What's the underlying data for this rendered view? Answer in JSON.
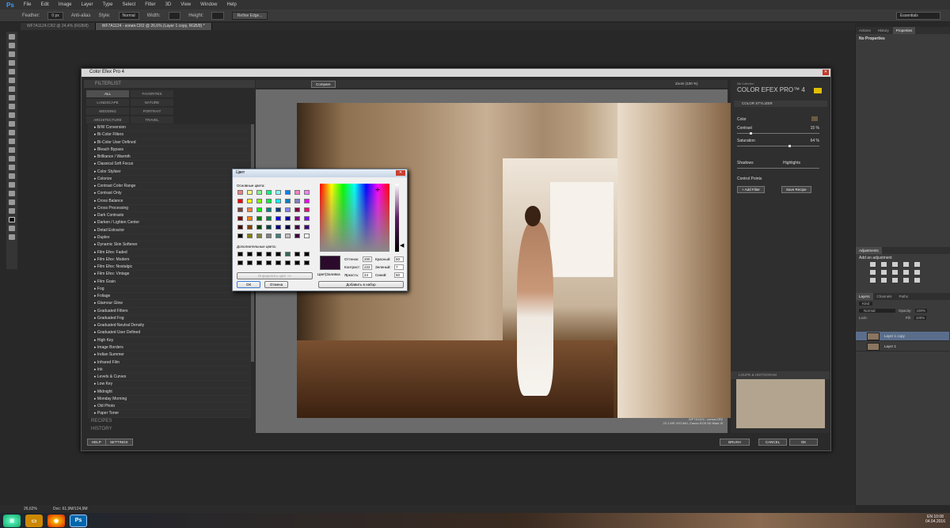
{
  "menubar": {
    "logo": "Ps",
    "items": [
      "File",
      "Edit",
      "Image",
      "Layer",
      "Type",
      "Select",
      "Filter",
      "3D",
      "View",
      "Window",
      "Help"
    ]
  },
  "options": {
    "feather_label": "Feather:",
    "feather_value": "0 px",
    "antialias": "Anti-alias",
    "style_label": "Style:",
    "style_value": "Normal",
    "width_label": "Width:",
    "height_label": "Height:",
    "refine_edge": "Refine Edge...",
    "workspace": "Essentials"
  },
  "doc_tabs": [
    "WF7A1124.CR2 @ 24,4% (RGB/8)",
    "WF7A1124 - копия.CR2 @ 26,6% (Layer 1 copy, RGB/8) *"
  ],
  "plugin": {
    "title": "Color Efex Pro 4",
    "filterlist_head": "FILTERLIST",
    "categories": [
      [
        "ALL",
        "FAVORITES"
      ],
      [
        "LANDSCAPE",
        "NATURE"
      ],
      [
        "WEDDING",
        "PORTRAIT"
      ],
      [
        "ARCHITECTURE",
        "TRAVEL"
      ]
    ],
    "filters": [
      "B/W Conversion",
      "Bi-Color Filters",
      "Bi-Color User Defined",
      "Bleach Bypass",
      "Brilliance / Warmth",
      "Classical Soft Focus",
      "Color Stylizer",
      "Colorize",
      "Contrast Color Range",
      "Contrast Only",
      "Cross Balance",
      "Cross Processing",
      "Dark Contrasts",
      "Darken / Lighten Center",
      "Detail Extractor",
      "Duplex",
      "Dynamic Skin Softener",
      "Film Efex: Faded",
      "Film Efex: Modern",
      "Film Efex: Nostalgic",
      "Film Efex: Vintage",
      "Film Grain",
      "Fog",
      "Foliage",
      "Glamour Glow",
      "Graduated Filters",
      "Graduated Fog",
      "Graduated Neutral Density",
      "Graduated User Defined",
      "High Key",
      "Image Borders",
      "Indian Summer",
      "Infrared Film",
      "Ink",
      "Levels & Curves",
      "Low Key",
      "Midnight",
      "Monday Morning",
      "Old Photo",
      "Paper Toner"
    ],
    "recipes": "RECIPES",
    "history": "HISTORY",
    "help": "HELP",
    "settings": "SETTINGS",
    "compare": "Compare",
    "zoom": "Zoom (100 %)",
    "image_info": [
      "WF7A1124 - копия.CR2",
      "22.1 MP, ISO 640, Canon EOS 5D Mark III"
    ],
    "brand_small": "Nik Collection",
    "brand": "COLOR EFEX PRO™ 4",
    "stylizer": "COLOR STYLIZER",
    "color_label": "Color",
    "contrast_label": "Contrast",
    "contrast_value": "15 %",
    "saturation_label": "Saturation",
    "saturation_value": "64 %",
    "shadows": "Shadows",
    "highlights": "Highlights",
    "control_points": "Control Points",
    "add_filter": "+ Add Filter",
    "save_recipe": "Save Recipe",
    "loupe": "LOUPE & HISTOGRAM",
    "brush": "BRUSH",
    "cancel": "CANCEL",
    "ok": "OK"
  },
  "color_dialog": {
    "title": "Цвет",
    "basic_label": "Основные цвета:",
    "custom_label": "Дополнительные цвета:",
    "define": "Определить цвет >>",
    "ok": "ОК",
    "cancel": "Отмена",
    "color_solid": "Цвет|Заливка",
    "hue_label": "Оттенок:",
    "hue": "200",
    "sat_label": "Контраст:",
    "sat": "222",
    "lum_label": "Яркость:",
    "lum": "24",
    "red_label": "Красный:",
    "red": "50",
    "green_label": "Зеленый:",
    "green": "7",
    "blue_label": "Синий:",
    "blue": "50",
    "add_custom": "Добавить в набор",
    "basic_colors": [
      "#f08080",
      "#ffff80",
      "#80ff80",
      "#00ff80",
      "#80ffff",
      "#0080ff",
      "#ff80c0",
      "#ff80ff",
      "#ff0000",
      "#ffff00",
      "#80ff00",
      "#00ff40",
      "#00ffff",
      "#0080c0",
      "#8080c0",
      "#ff00ff",
      "#804040",
      "#ff8040",
      "#00ff00",
      "#008080",
      "#004080",
      "#8080ff",
      "#800040",
      "#ff0080",
      "#800000",
      "#ff8000",
      "#008000",
      "#008040",
      "#0000ff",
      "#0000a0",
      "#800080",
      "#8000ff",
      "#400000",
      "#804000",
      "#004000",
      "#004040",
      "#000080",
      "#000040",
      "#400040",
      "#400080",
      "#000000",
      "#808000",
      "#808040",
      "#808080",
      "#408080",
      "#c0c0c0",
      "#400040",
      "#ffffff"
    ],
    "custom_colors": [
      "#000000",
      "#000000",
      "#000000",
      "#000000",
      "#000000",
      "#2e6b5b",
      "#000000",
      "#000000",
      "#000000",
      "#000000",
      "#000000",
      "#000000",
      "#000000",
      "#000000",
      "#000000",
      "#000000"
    ]
  },
  "right_panel": {
    "tabs": [
      "Actions",
      "History",
      "Properties"
    ],
    "properties_text": "No Properties",
    "adj_tabs": [
      "Adjustments"
    ],
    "adj_title": "Add an adjustment",
    "layer_tabs": [
      "Layers",
      "Channels",
      "Paths"
    ],
    "kind": "Kind",
    "blend": "Normal",
    "opacity_label": "Opacity:",
    "opacity": "100%",
    "lock_label": "Lock:",
    "fill_label": "Fill:",
    "fill": "100%",
    "layers": [
      "Layer 1 copy",
      "Layer 1"
    ]
  },
  "status": {
    "zoom": "26,62%",
    "doc": "Doc: 61,9M/124,9M"
  },
  "tray": {
    "lang": "EN",
    "time": "10:08",
    "date": "04.04.2016"
  }
}
